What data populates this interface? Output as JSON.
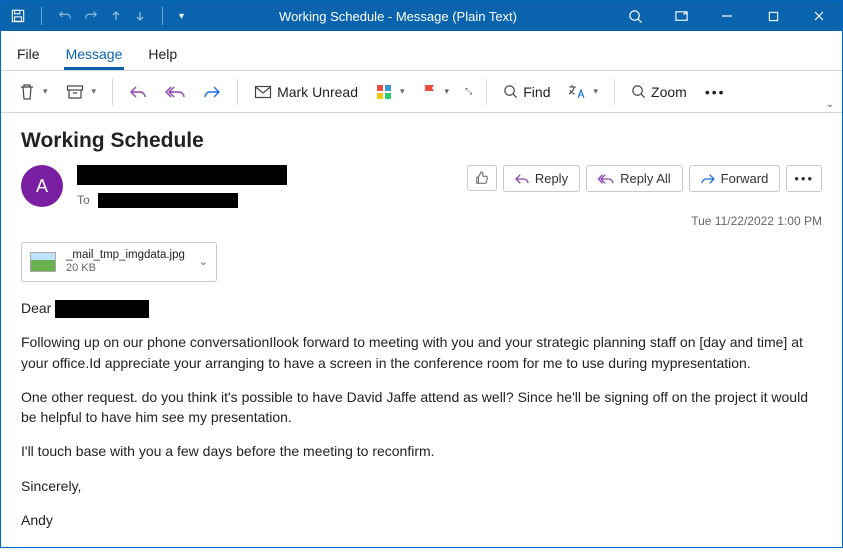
{
  "window": {
    "title": "Working Schedule  -  Message (Plain Text)"
  },
  "menu": {
    "file": "File",
    "message": "Message",
    "help": "Help"
  },
  "ribbon": {
    "mark_unread": "Mark Unread",
    "find": "Find",
    "zoom": "Zoom"
  },
  "email": {
    "subject": "Working Schedule",
    "avatar_initial": "A",
    "to_label": "To",
    "actions": {
      "reply": "Reply",
      "reply_all": "Reply All",
      "forward": "Forward"
    },
    "datetime": "Tue 11/22/2022 1:00 PM",
    "attachment": {
      "name": "_mail_tmp_imgdata.jpg",
      "size": "20 KB"
    },
    "body": {
      "greeting": "Dear",
      "p1": "Following up on our phone conversationIlook forward to meeting with you and your strategic planning staff on [day and time] at your office.Id appreciate your arranging to have a screen in the conference room for me to use during mypresentation.",
      "p2": "One other request. do you think it's possible to have David Jaffe attend as well? Since he'll be signing off on the project it would be helpful to have him see my presentation.",
      "p3": "I'll touch base with you a few days before the meeting to reconfirm.",
      "signoff": "Sincerely,",
      "sender": "Andy"
    }
  }
}
